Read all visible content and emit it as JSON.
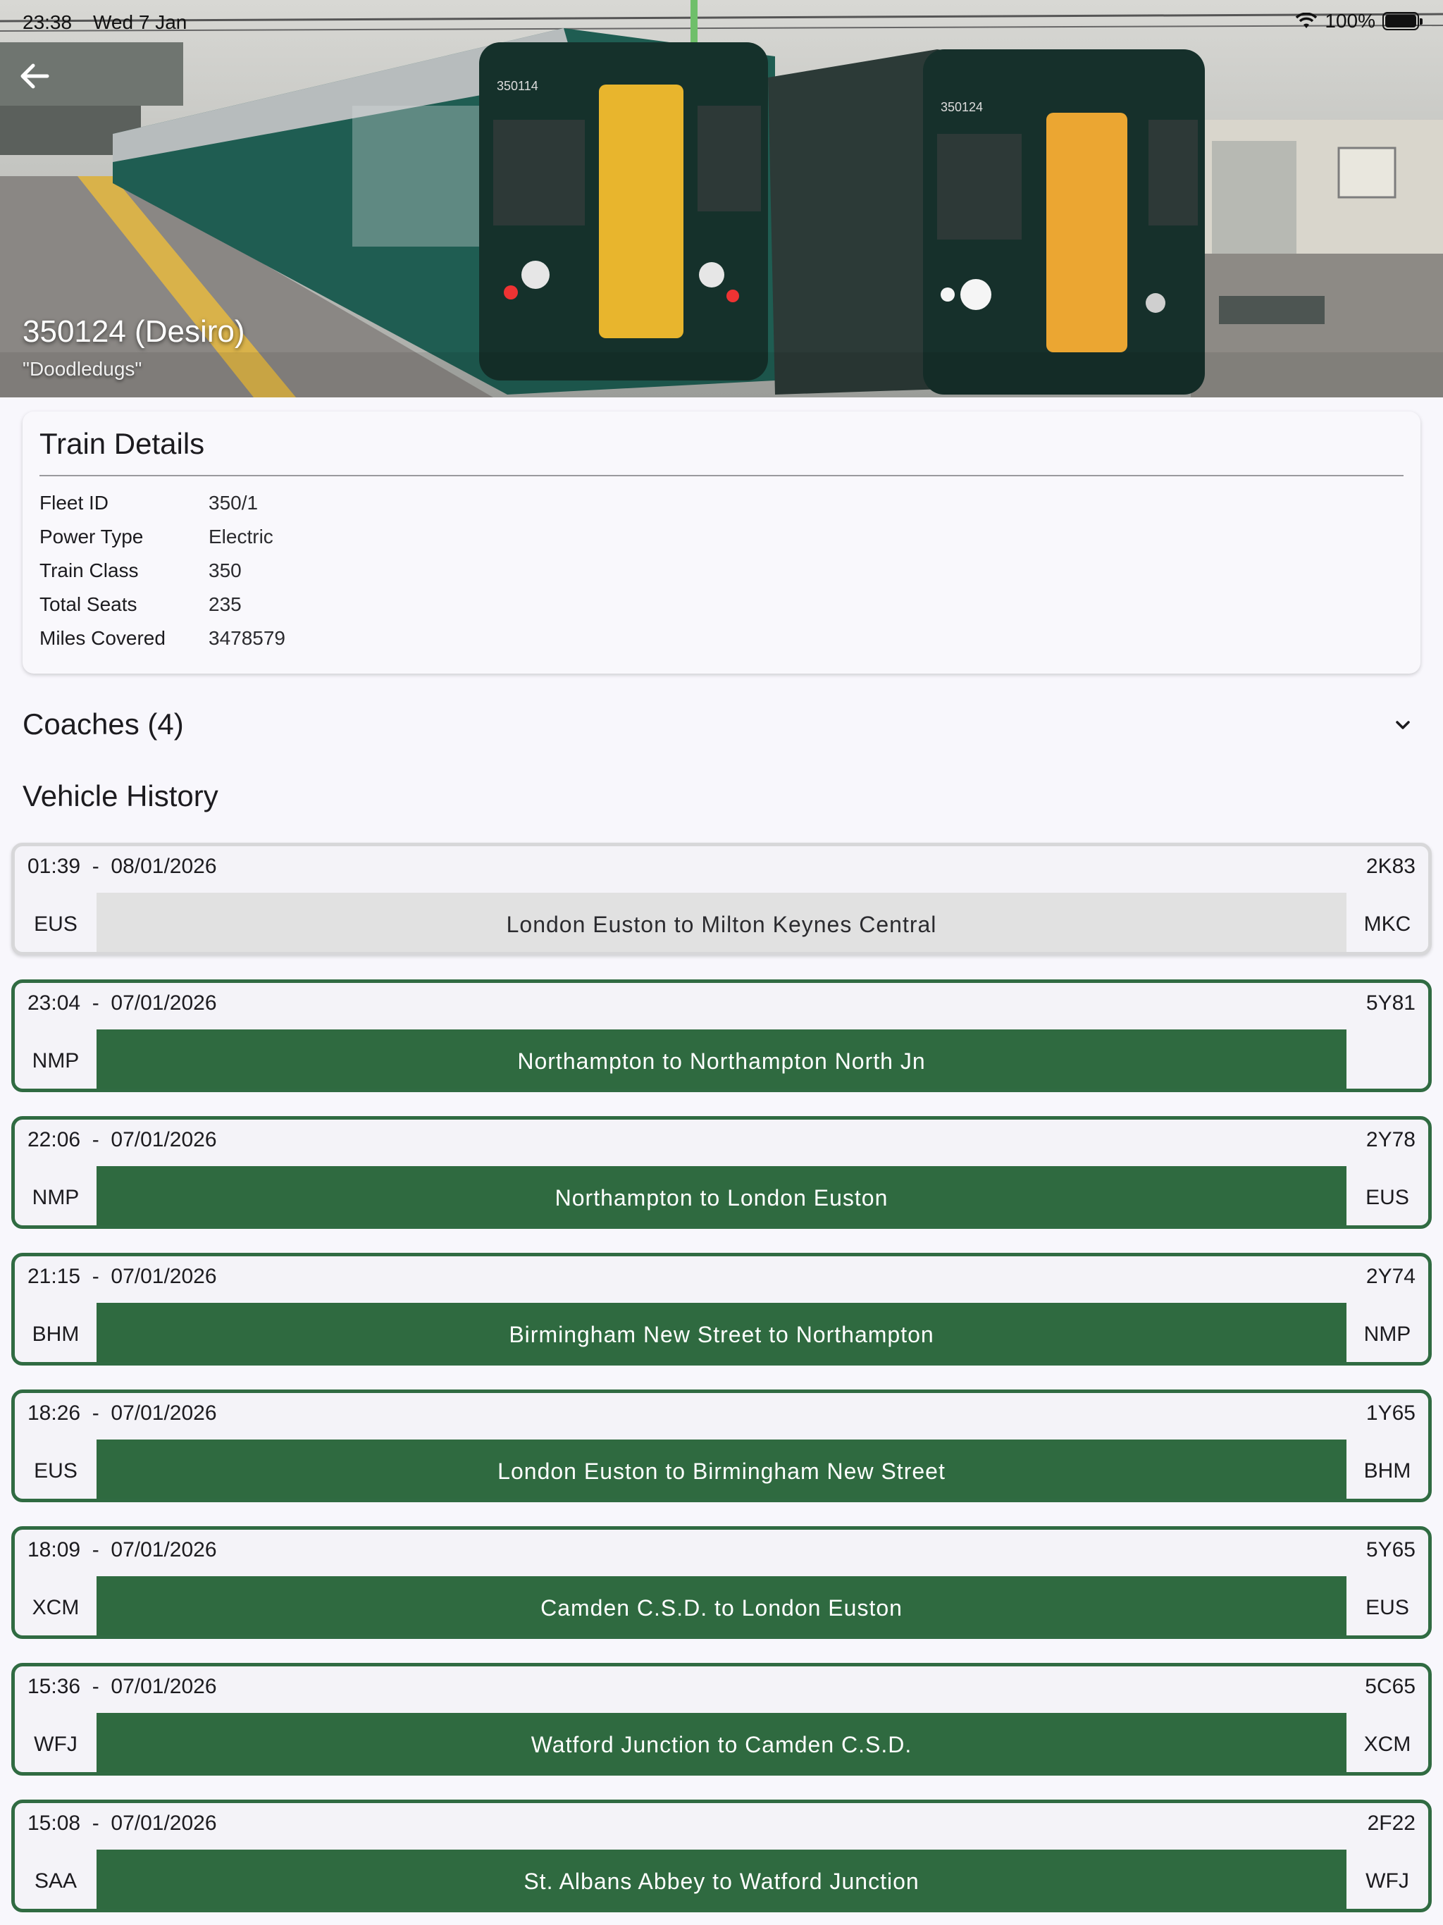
{
  "status_bar": {
    "time": "23:38",
    "date": "Wed 7 Jan",
    "battery": "100%"
  },
  "hero": {
    "title": "350124 (Desiro)",
    "subtitle": "\"Doodledugs\"",
    "image_icon": "train-photo",
    "back_icon": "arrow-left-icon"
  },
  "details": {
    "title": "Train Details",
    "rows": [
      {
        "label": "Fleet ID",
        "value": "350/1"
      },
      {
        "label": "Power Type",
        "value": "Electric"
      },
      {
        "label": "Train Class",
        "value": "350"
      },
      {
        "label": "Total Seats",
        "value": "235"
      },
      {
        "label": "Miles Covered",
        "value": "3478579"
      }
    ]
  },
  "coaches": {
    "title": "Coaches (4)",
    "icon": "chevron-down-icon"
  },
  "history": {
    "title": "Vehicle History",
    "entries": [
      {
        "time": "01:39  -  08/01/2026",
        "code": "2K83",
        "from": "EUS",
        "route": "London Euston to Milton Keynes Central",
        "to": "MKC",
        "current": true
      },
      {
        "time": "23:04  -  07/01/2026",
        "code": "5Y81",
        "from": "NMP",
        "route": "Northampton to Northampton North Jn",
        "to": "",
        "current": false
      },
      {
        "time": "22:06  -  07/01/2026",
        "code": "2Y78",
        "from": "NMP",
        "route": "Northampton to London Euston",
        "to": "EUS",
        "current": false
      },
      {
        "time": "21:15  -  07/01/2026",
        "code": "2Y74",
        "from": "BHM",
        "route": "Birmingham New Street to Northampton",
        "to": "NMP",
        "current": false
      },
      {
        "time": "18:26  -  07/01/2026",
        "code": "1Y65",
        "from": "EUS",
        "route": "London Euston to Birmingham New Street",
        "to": "BHM",
        "current": false
      },
      {
        "time": "18:09  -  07/01/2026",
        "code": "5Y65",
        "from": "XCM",
        "route": "Camden C.S.D. to London Euston",
        "to": "EUS",
        "current": false
      },
      {
        "time": "15:36  -  07/01/2026",
        "code": "5C65",
        "from": "WFJ",
        "route": "Watford Junction to Camden C.S.D.",
        "to": "XCM",
        "current": false
      },
      {
        "time": "15:08  -  07/01/2026",
        "code": "2F22",
        "from": "SAA",
        "route": "St. Albans Abbey to Watford Junction",
        "to": "WFJ",
        "current": false
      }
    ]
  },
  "colors": {
    "route_bar": "#2f6a40",
    "route_border": "#306b42",
    "current_bar": "#e1e1e1",
    "background": "#f8f7fc"
  }
}
